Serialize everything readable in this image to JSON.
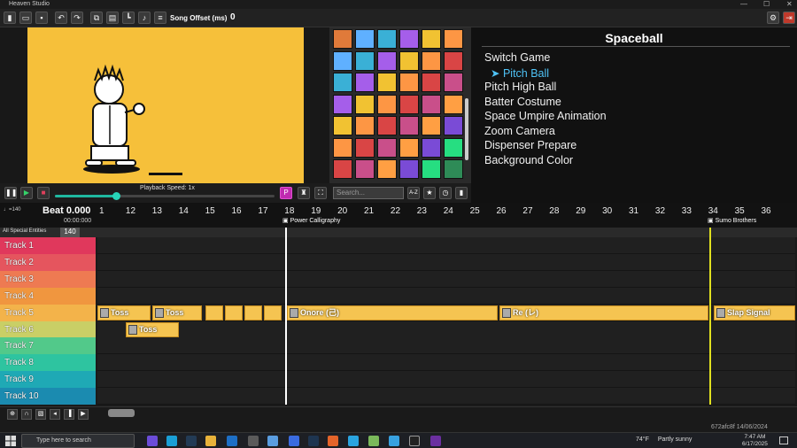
{
  "window": {
    "title": "Heaven Studio"
  },
  "toolbar": {
    "song_offset_label": "Song Offset (ms)",
    "song_offset_value": "0"
  },
  "playback": {
    "speed_label": "Playback Speed: 1x",
    "speed_fraction": 0.28
  },
  "game_select": {
    "search_placeholder": "Search...",
    "sort_label": "A-Z"
  },
  "events": {
    "game_title": "Spaceball",
    "items": [
      "Switch Game",
      "Pitch Ball",
      "Pitch High Ball",
      "Batter Costume",
      "Space Umpire Animation",
      "Zoom Camera",
      "Dispenser Prepare",
      "Background Color"
    ],
    "selected_index": 1,
    "selected_marker": "➤"
  },
  "timeline": {
    "bpm_small": "♩=140",
    "beat_label": "Beat 0.000",
    "time_label": "00:00:000",
    "special_entities_label": "All Special Entities",
    "tempo_value": "140",
    "beat_numbers": [
      "1",
      "12",
      "13",
      "14",
      "15",
      "16",
      "17",
      "18",
      "19",
      "20",
      "21",
      "22",
      "23",
      "24",
      "25",
      "26",
      "27",
      "28",
      "29",
      "30",
      "31",
      "32",
      "33",
      "34",
      "35",
      "36"
    ],
    "game_switch_markers": [
      "Power Calligraphy",
      "Sumo Brothers"
    ],
    "tracks": [
      "Track 1",
      "Track 2",
      "Track 3",
      "Track 4",
      "Track 5",
      "Track 6",
      "Track 7",
      "Track 8",
      "Track 9",
      "Track 10"
    ],
    "track_colors": [
      "#e0385c",
      "#e5555e",
      "#ee7a52",
      "#f0963f",
      "#f3b34a",
      "#c9cf66",
      "#52c98a",
      "#2ec4a0",
      "#1fa9b5",
      "#1b8bb0"
    ],
    "blocks": [
      {
        "label": "Toss",
        "track": 5
      },
      {
        "label": "Toss",
        "track": 5
      },
      {
        "label": "Onore (己)",
        "track": 5
      },
      {
        "label": "Re (レ)",
        "track": 5
      },
      {
        "label": "Slap Signal",
        "track": 5
      },
      {
        "label": "Toss",
        "track": 6
      }
    ]
  },
  "status": {
    "version": "672afc8f 14/06/2024"
  },
  "taskbar": {
    "search_placeholder": "Type here to search",
    "weather_temp": "74°F",
    "weather_text": "Partly sunny",
    "time": "7:47 AM",
    "date": "6/17/2025"
  }
}
